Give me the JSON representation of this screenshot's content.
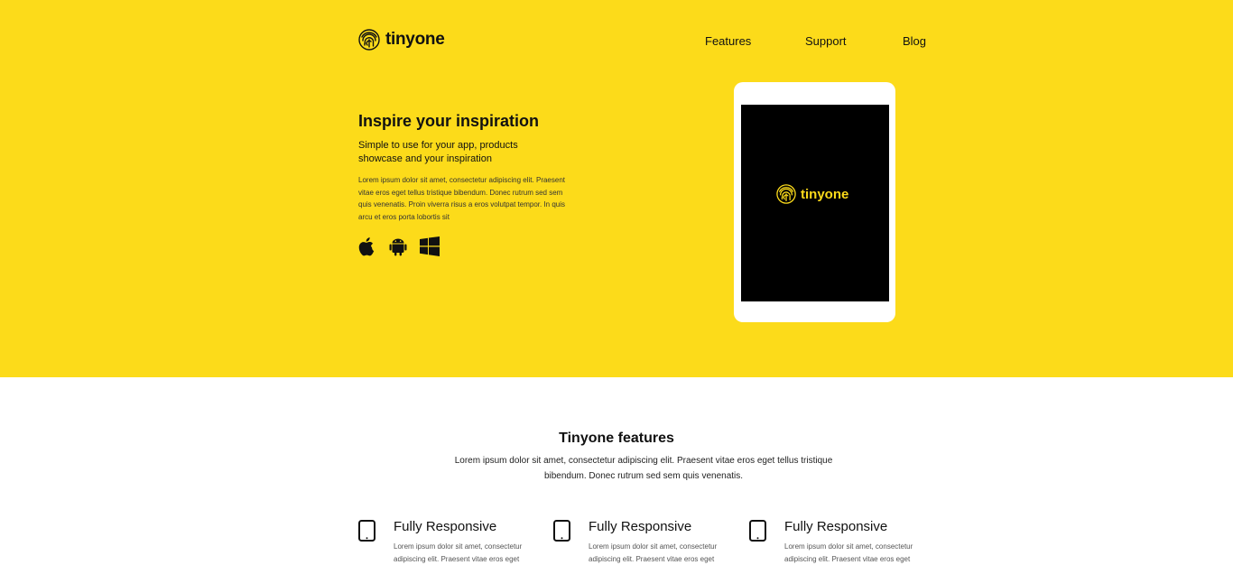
{
  "header": {
    "brand": "tinyone",
    "nav": [
      "Features",
      "Support",
      "Blog"
    ]
  },
  "hero": {
    "title": "Inspire your inspiration",
    "subtitle": "Simple to use for your app, products showcase and your inspiration",
    "body": "Lorem ipsum dolor sit amet, consectetur adipiscing elit. Praesent vitae eros eget tellus tristique bibendum. Donec rutrum sed sem quis venenatis. Proin viverra risus a eros volutpat tempor. In quis arcu et eros porta lobortis sit",
    "platform_icons": [
      "apple-icon",
      "android-icon",
      "windows-icon"
    ],
    "tablet_brand": "tinyone"
  },
  "features": {
    "title": "Tinyone features",
    "description": "Lorem ipsum dolor sit amet, consectetur adipiscing elit. Praesent vitae eros eget tellus tristique bibendum. Donec rutrum sed sem quis venenatis.",
    "items": [
      {
        "icon": "tablet-icon",
        "title": "Fully Responsive",
        "text": "Lorem ipsum dolor sit amet, consectetur adipiscing elit. Praesent vitae eros eget"
      },
      {
        "icon": "tablet-icon",
        "title": "Fully Responsive",
        "text": "Lorem ipsum dolor sit amet, consectetur adipiscing elit. Praesent vitae eros eget"
      },
      {
        "icon": "tablet-icon",
        "title": "Fully Responsive",
        "text": "Lorem ipsum dolor sit amet, consectetur adipiscing elit. Praesent vitae eros eget"
      }
    ]
  },
  "colors": {
    "accent": "#fcdb1a",
    "dark": "#111111",
    "background": "#ffffff"
  }
}
